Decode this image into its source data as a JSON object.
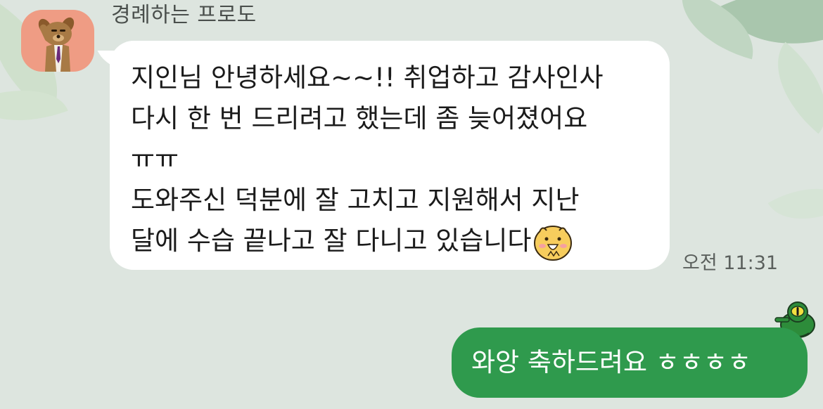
{
  "chat": {
    "sender_name": "경례하는 프로도",
    "incoming": {
      "lines": [
        "지인님 안녕하세요~~!! 취업하고 감사인사",
        "다시 한 번 드리려고 했는데 좀 늦어졌어요",
        "ㅠㅠ",
        "도와주신 덕분에 잘 고치고 지원해서 지난",
        "달에 수습 끝나고 잘 다니고 있습니다"
      ],
      "time": "오전 11:31"
    },
    "outgoing": {
      "text": "와앙 축하드려요 ㅎㅎㅎㅎ"
    }
  },
  "colors": {
    "background": "#dde5df",
    "incoming_bubble": "#ffffff",
    "outgoing_bubble": "#2f9a4d",
    "avatar_bg": "#ef9c84"
  },
  "icons": {
    "avatar": "frodo-saluting-avatar",
    "emoji": "chunsik-happy-emoji",
    "sticker": "green-frog-sticker"
  }
}
